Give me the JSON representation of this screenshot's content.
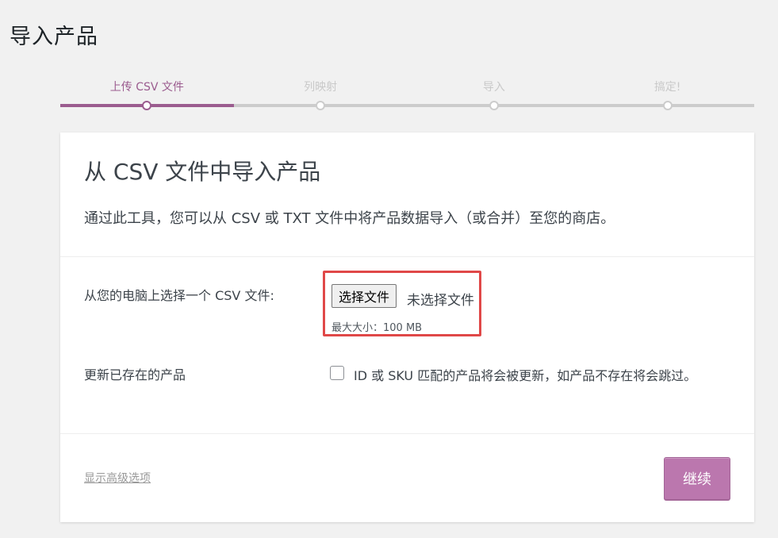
{
  "page": {
    "title": "导入产品"
  },
  "steps": [
    {
      "label": "上传 CSV 文件",
      "active": true
    },
    {
      "label": "列映射",
      "active": false
    },
    {
      "label": "导入",
      "active": false
    },
    {
      "label": "搞定!",
      "active": false
    }
  ],
  "card": {
    "title": "从 CSV 文件中导入产品",
    "description": "通过此工具，您可以从 CSV 或 TXT 文件中将产品数据导入（或合并）至您的商店。",
    "file_row": {
      "label": "从您的电脑上选择一个 CSV 文件:",
      "button_label": "选择文件",
      "status": "未选择文件",
      "max_size": "最大大小：100 MB"
    },
    "update_row": {
      "label": "更新已存在的产品",
      "checkbox_label": "ID 或 SKU 匹配的产品将会被更新，如产品不存在将会跳过。",
      "checked": false
    },
    "advanced_link": "显示高级选项",
    "continue_button": "继续"
  },
  "colors": {
    "accent": "#9b5c8f",
    "button": "#bb77ae",
    "highlight_border": "#e04848"
  }
}
